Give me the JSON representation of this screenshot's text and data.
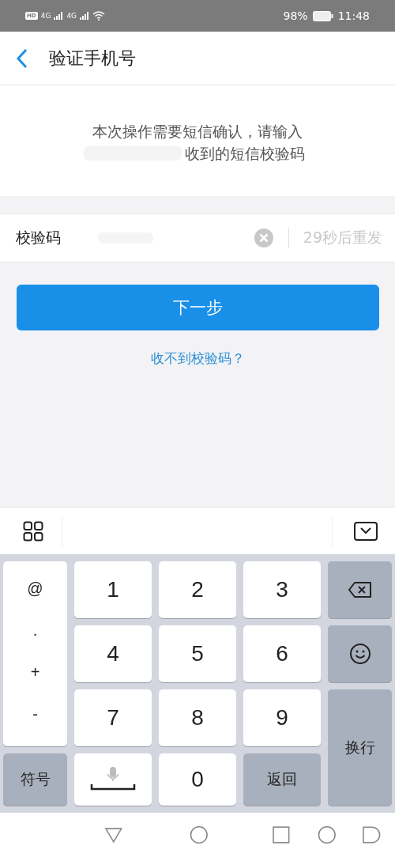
{
  "status_bar": {
    "hd": "HD",
    "networks": [
      "4G",
      "4G"
    ],
    "battery": "98%",
    "time": "11:48"
  },
  "header": {
    "title": "验证手机号"
  },
  "message": {
    "line1": "本次操作需要短信确认，请输入",
    "line2": "收到的短信校验码"
  },
  "code_field": {
    "label": "校验码",
    "resend": "29秒后重发",
    "resend_disabled": true
  },
  "next_button": "下一步",
  "help_link": "收不到校验码？",
  "keyboard": {
    "side_symbols": [
      "@",
      ".",
      "+",
      "-"
    ],
    "digits": [
      "1",
      "2",
      "3",
      "4",
      "5",
      "6",
      "7",
      "8",
      "9",
      "0"
    ],
    "symbols_key": "符号",
    "back_key": "返回",
    "enter_key": "换行"
  }
}
